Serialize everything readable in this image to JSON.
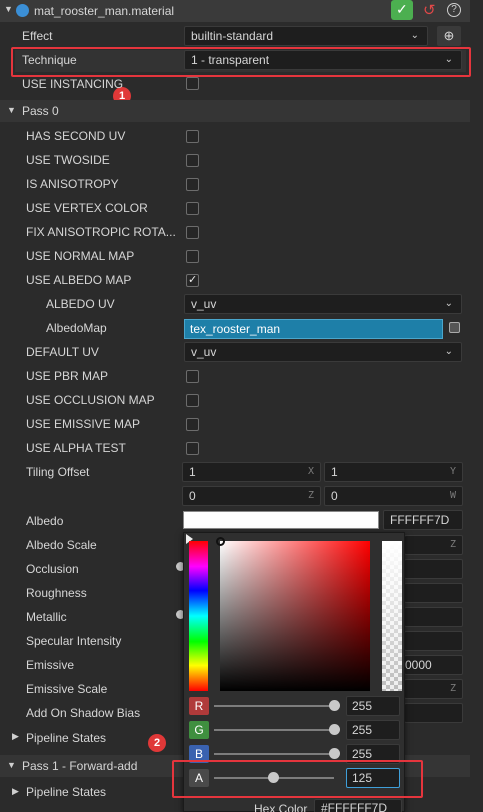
{
  "header": {
    "file_name": "mat_rooster_man.material",
    "apply_icon": "checkmark-icon",
    "revert_icon": "revert-icon",
    "help_icon": "help-icon"
  },
  "effect": {
    "label": "Effect",
    "value": "builtin-standard"
  },
  "technique": {
    "label": "Technique",
    "value": "1 - transparent"
  },
  "use_instancing": {
    "label": "USE INSTANCING",
    "checked": false
  },
  "pass0": {
    "title": "Pass 0",
    "toggles": [
      {
        "label": "HAS SECOND UV",
        "checked": false
      },
      {
        "label": "USE TWOSIDE",
        "checked": false
      },
      {
        "label": "IS ANISOTROPY",
        "checked": false
      },
      {
        "label": "USE VERTEX COLOR",
        "checked": false
      },
      {
        "label": "FIX ANISOTROPIC ROTA...",
        "checked": false
      },
      {
        "label": "USE NORMAL MAP",
        "checked": false
      },
      {
        "label": "USE ALBEDO MAP",
        "checked": true
      }
    ],
    "albedo_uv": {
      "label": "ALBEDO UV",
      "value": "v_uv"
    },
    "albedo_map": {
      "label": "AlbedoMap",
      "value": "tex_rooster_man"
    },
    "default_uv": {
      "label": "DEFAULT UV",
      "value": "v_uv"
    },
    "toggles2": [
      {
        "label": "USE PBR MAP",
        "checked": false
      },
      {
        "label": "USE OCCLUSION MAP",
        "checked": false
      },
      {
        "label": "USE EMISSIVE MAP",
        "checked": false
      },
      {
        "label": "USE ALPHA TEST",
        "checked": false
      }
    ],
    "tiling_offset": {
      "label": "Tiling Offset",
      "x": "1",
      "y": "1",
      "z": "0",
      "w": "0",
      "units": {
        "x": "X",
        "y": "Y",
        "z": "Z",
        "w": "W"
      }
    },
    "albedo": {
      "label": "Albedo",
      "hex": "FFFFFF7D"
    },
    "props": [
      "Albedo Scale",
      "Occlusion",
      "Roughness",
      "Metallic",
      "Specular Intensity",
      "Emissive",
      "Emissive Scale",
      "Add On Shadow Bias"
    ],
    "emissive_value_tail": "0000",
    "albedo_scale_unit": "Z",
    "emissive_scale_unit": "Z",
    "pipeline_states": "Pipeline States"
  },
  "pass1": {
    "title": "Pass 1 - Forward-add",
    "pipeline_states": "Pipeline States"
  },
  "color_picker": {
    "channels": [
      {
        "name": "R",
        "value": "255",
        "color": "#b03a3a",
        "level": 1.0
      },
      {
        "name": "G",
        "value": "255",
        "color": "#3f8f3f",
        "level": 1.0
      },
      {
        "name": "B",
        "value": "255",
        "color": "#3a62b0",
        "level": 1.0
      },
      {
        "name": "A",
        "value": "125",
        "color": "#4a4a4a",
        "level": 0.49
      }
    ],
    "hex_label": "Hex Color",
    "hex_value": "#FFFFFF7D"
  },
  "annotations": {
    "badge1": "1",
    "badge2": "2"
  },
  "colors": {
    "accent": "#1e7fa8",
    "red_box": "#e5353d",
    "apply_green": "#4caf50"
  }
}
